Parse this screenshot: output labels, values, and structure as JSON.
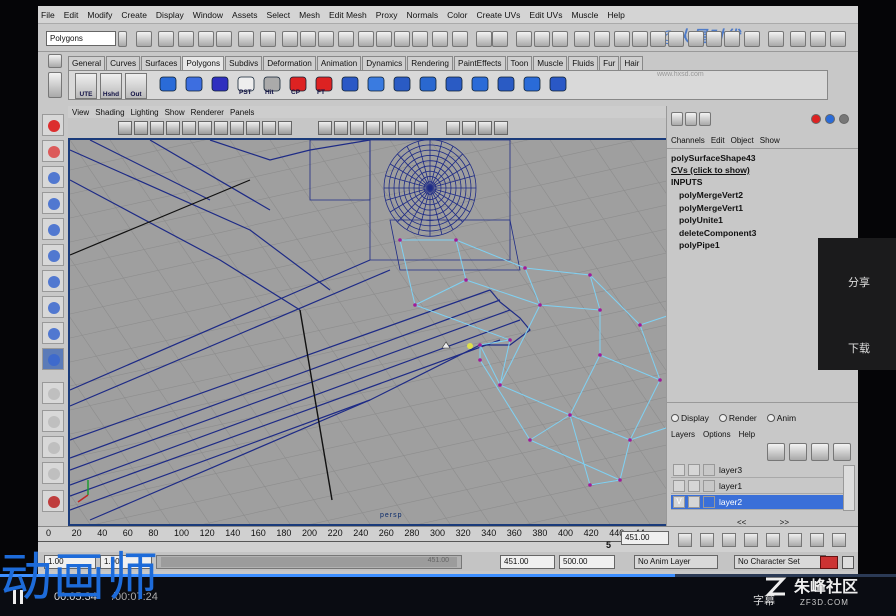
{
  "menu": [
    "File",
    "Edit",
    "Modify",
    "Create",
    "Display",
    "Window",
    "Assets",
    "Select",
    "Mesh",
    "Edit Mesh",
    "Proxy",
    "Normals",
    "Color",
    "Create UVs",
    "Edit UVs",
    "Muscle",
    "Help"
  ],
  "status": {
    "mode": "Polygons"
  },
  "shelf_tabs": [
    "General",
    "Curves",
    "Surfaces",
    "Polygons",
    "Subdivs",
    "Deformation",
    "Animation",
    "Dynamics",
    "Rendering",
    "PaintEffects",
    "Toon",
    "Muscle",
    "Fluids",
    "Fur",
    "Hair"
  ],
  "shelf_buttons": [
    "UTE",
    "Hshd",
    "Out"
  ],
  "shelf_icons": [
    "sphere-icon",
    "lasso-icon",
    "curve-icon",
    "pst-icon",
    "hist-icon",
    "cp-icon",
    "ft-icon",
    "cube-icon",
    "deform-icon",
    "mesh-icon",
    "extrude-icon",
    "split-icon",
    "combine-icon",
    "poly-icon",
    "flatten-icon",
    "bevel-icon"
  ],
  "shelf_icon_labels": {
    "hist": "Hit",
    "pst": "PST",
    "cp": "CP",
    "ft": "FT"
  },
  "viewport": {
    "menu": [
      "View",
      "Shading",
      "Lighting",
      "Show",
      "Renderer",
      "Panels"
    ],
    "camera": "persp"
  },
  "channel_box": {
    "tabs": [
      "Channels",
      "Edit",
      "Object",
      "Show"
    ],
    "shape": "polySurfaceShape43",
    "cvs": "CVs (click to show)",
    "inputs_label": "INPUTS",
    "history": [
      "polyMergeVert2",
      "polyMergeVert1",
      "polyUnite1",
      "deleteComponent3",
      "polyPipe1"
    ]
  },
  "layers": {
    "modes": [
      "Display",
      "Render",
      "Anim"
    ],
    "menu": [
      "Layers",
      "Options",
      "Help"
    ],
    "items": [
      {
        "name": "layer3",
        "v": ""
      },
      {
        "name": "layer1",
        "v": ""
      },
      {
        "name": "layer2",
        "v": "V"
      }
    ]
  },
  "timeline": {
    "start": 0,
    "step": 20,
    "end": 440,
    "tail": "44",
    "current": "451.00",
    "range_tail": "5"
  },
  "range": {
    "start": "1.00",
    "cur": "1.00",
    "slider_label": "451.00",
    "end": "451.00",
    "anim_end": "500.00",
    "anim_layer": "No Anim Layer",
    "char_set": "No Character Set"
  },
  "player": {
    "time": "00:05:34",
    "duration": "/00:07:24",
    "progress": 0.753
  },
  "side": {
    "share": "分享",
    "download": "下载"
  },
  "watermark": {
    "bottom_left": "动画师",
    "brand": "朱峰社区",
    "brand_url": "ZF3D.COM",
    "brand_prefix": "字幕",
    "logo_url": "www.hxsd.com"
  },
  "colors": {
    "viewport_bg": "#9f9f9f",
    "wire_dark": "#1e2b86",
    "wire_light": "#7fd1f3",
    "vertex": "#a01c9a",
    "selection": "#3a6fd8"
  }
}
